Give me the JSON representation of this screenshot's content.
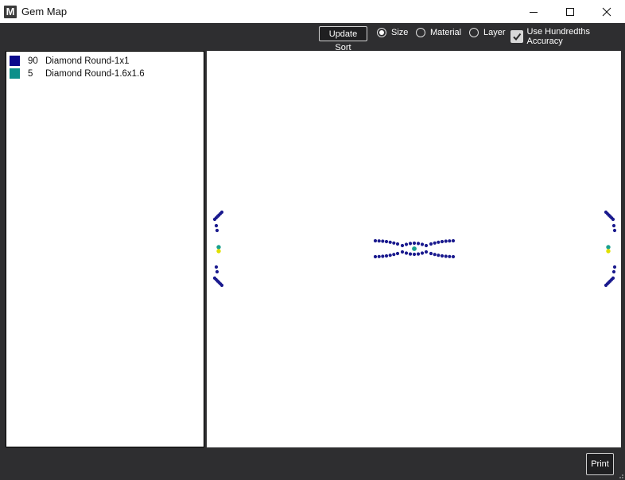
{
  "window": {
    "title": "Gem Map"
  },
  "toolbar": {
    "update_sort_label": "Update Sort",
    "sort_options": [
      {
        "label": "Size",
        "selected": true
      },
      {
        "label": "Material",
        "selected": false
      },
      {
        "label": "Layer",
        "selected": false
      }
    ],
    "hundredths_label": "Use Hundredths Accuracy",
    "hundredths_checked": true
  },
  "legend": {
    "items": [
      {
        "count": "90",
        "name": "Diamond Round-1x1",
        "color": "#0a0a8c"
      },
      {
        "count": "5",
        "name": "Diamond Round-1.6x1.6",
        "color": "#0b8f8a"
      }
    ]
  },
  "gem_map": {
    "small_gem_color": "#1a1a8e",
    "large_gem_color": "#1aa08f",
    "large_gem_highlight": "#e0e000"
  },
  "footer": {
    "print_label": "Print"
  }
}
